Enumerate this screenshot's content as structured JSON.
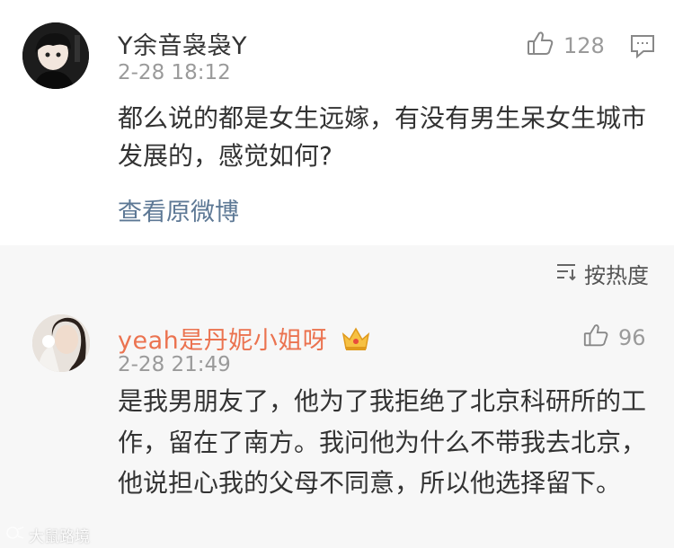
{
  "comments": [
    {
      "username": "Y余音袅袅Y",
      "timestamp": "2-28 18:12",
      "content": "都么说的都是女生远嫁，有没有男生呆女生城市发展的，感觉如何?",
      "likes": "128",
      "view_original": "查看原微博",
      "icons": [
        "avatar",
        "thumbs-up-icon",
        "reply-icon"
      ]
    },
    {
      "username": "yeah是丹妮小姐呀",
      "timestamp": "2-28 21:49",
      "content": "是我男朋友了，他为了我拒绝了北京科研所的工作，留在了南方。我问他为什么不带我去北京，他说担心我的父母不同意，所以他选择留下。",
      "likes": "96",
      "icons": [
        "avatar",
        "crown-icon",
        "thumbs-up-icon"
      ]
    }
  ],
  "sort": {
    "label": "按热度",
    "icon": "sort-icon"
  },
  "watermark": "大鼠路境",
  "colors": {
    "username_highlight": "#eb7350",
    "link": "#5d7895",
    "meta": "#9a9a9a",
    "background": "#f7f7f7"
  }
}
